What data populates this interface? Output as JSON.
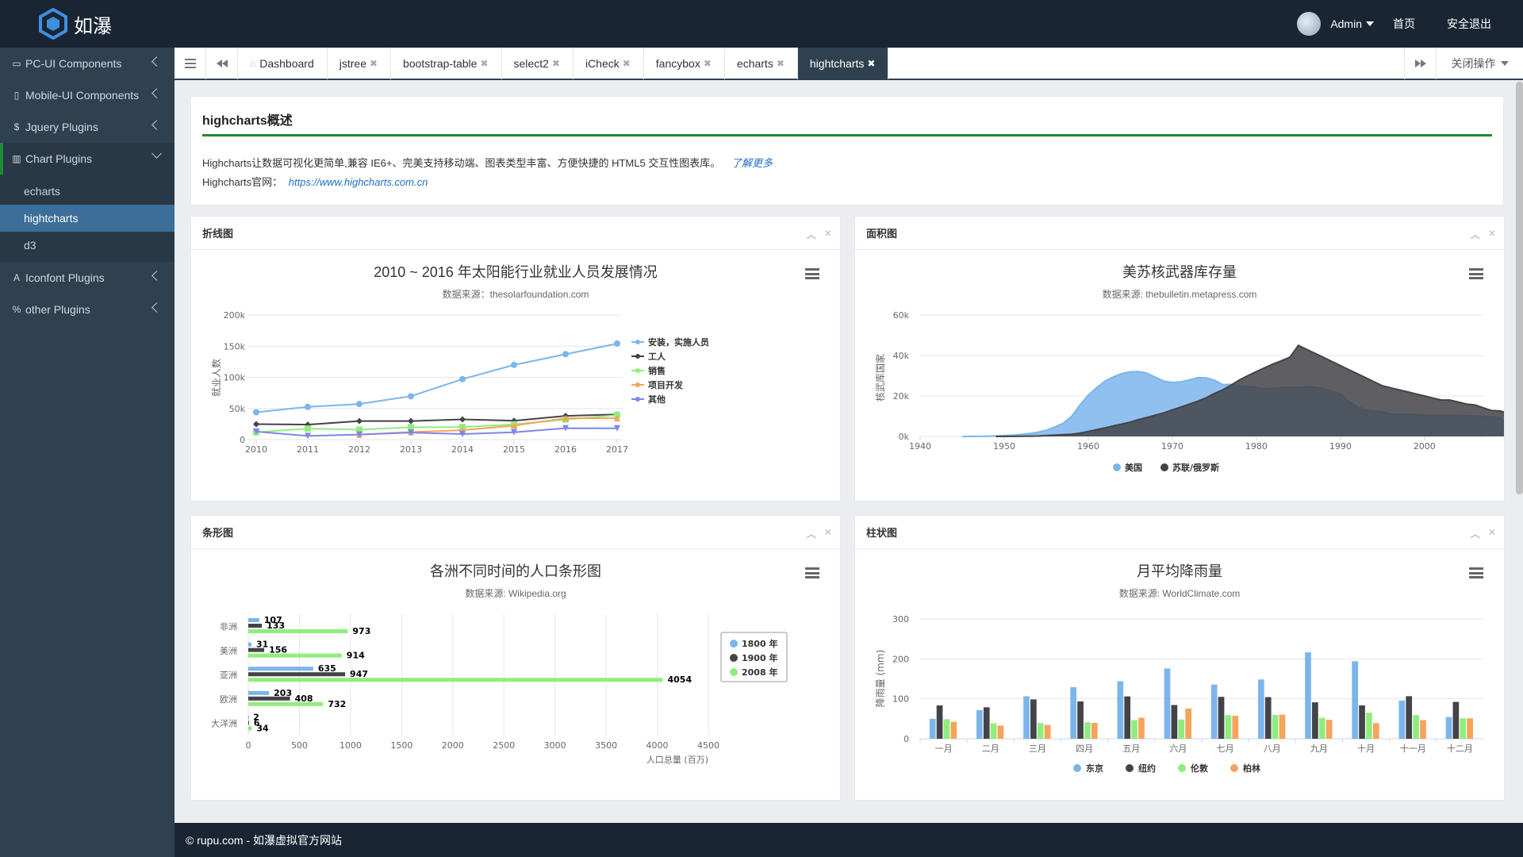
{
  "brand": {
    "name": "如瀑"
  },
  "topnav": {
    "user": "Admin",
    "home": "首页",
    "logout": "安全退出"
  },
  "sidebar": {
    "items": [
      {
        "icon": "desktop-icon",
        "glyph": "▭",
        "label": "PC-UI Components"
      },
      {
        "icon": "mobile-icon",
        "glyph": "▯",
        "label": "Mobile-UI Components"
      },
      {
        "icon": "dollar-icon",
        "glyph": "$",
        "label": "Jquery Plugins"
      },
      {
        "icon": "bar-chart-icon",
        "glyph": "▥",
        "label": "Chart Plugins",
        "open": true,
        "sub": [
          "echarts",
          "hightcharts",
          "d3"
        ],
        "active": "hightcharts"
      },
      {
        "icon": "font-icon",
        "glyph": "A",
        "label": "Iconfont Plugins"
      },
      {
        "icon": "link-icon",
        "glyph": "%",
        "label": "other Plugins"
      }
    ]
  },
  "tabs": {
    "items": [
      "Dashboard",
      "jstree",
      "bootstrap-table",
      "select2",
      "iCheck",
      "fancybox",
      "echarts",
      "hightcharts"
    ],
    "active": "hightcharts",
    "close_ops": "关闭操作"
  },
  "overview": {
    "title": "highcharts概述",
    "text": "Highcharts让数据可视化更简单,兼容 IE6+、完美支持移动端、图表类型丰富、方便快捷的 HTML5 交互性图表库。",
    "more": "了解更多",
    "site_label": "Highcharts官网：",
    "site_url": "https://www.highcharts.com.cn"
  },
  "panels": {
    "line": "折线图",
    "area": "面积图",
    "bar": "条形图",
    "column": "柱状图"
  },
  "colors": {
    "blue": "#7cb5ec",
    "dark": "#434348",
    "green": "#90ed7d",
    "orange": "#f7a35c",
    "purple": "#8085e9",
    "accent": "#1d8a34",
    "sidebar": "#2f4050",
    "topbar": "#1a2533"
  },
  "footer": "© rupu.com - 如瀑虚拟官方网站",
  "chart_data": [
    {
      "type": "line",
      "title": "2010 ~ 2016 年太阳能行业就业人员发展情况",
      "subtitle": "数据来源：thesolarfoundation.com",
      "ylabel": "就业人数",
      "ylim": [
        0,
        200000
      ],
      "yticks": [
        "0",
        "50k",
        "100k",
        "150k",
        "200k"
      ],
      "x": [
        "2010",
        "2011",
        "2012",
        "2013",
        "2014",
        "2015",
        "2016",
        "2017"
      ],
      "legend_position": "right",
      "series": [
        {
          "name": "安装，实施人员",
          "color": "#7cb5ec",
          "marker": "circle",
          "values": [
            43934,
            52503,
            57177,
            69658,
            97031,
            119931,
            137133,
            154175
          ]
        },
        {
          "name": "工人",
          "color": "#434348",
          "marker": "diamond",
          "values": [
            24916,
            24064,
            29742,
            29851,
            32490,
            30282,
            38121,
            40434
          ]
        },
        {
          "name": "销售",
          "color": "#90ed7d",
          "marker": "square",
          "values": [
            11744,
            17722,
            16005,
            19771,
            20185,
            24377,
            32147,
            39387
          ]
        },
        {
          "name": "项目开发",
          "color": "#f7a35c",
          "marker": "triangle",
          "values": [
            null,
            null,
            7988,
            12169,
            15112,
            22452,
            34400,
            34227
          ]
        },
        {
          "name": "其他",
          "color": "#8085e9",
          "marker": "triangle-down",
          "values": [
            12908,
            5948,
            8105,
            11248,
            8989,
            11816,
            18274,
            18111
          ]
        }
      ]
    },
    {
      "type": "area",
      "title": "美苏核武器库存量",
      "subtitle": "数据来源: thebulletin.metapress.com",
      "ylabel": "核武库国家",
      "ylim": [
        0,
        60000
      ],
      "yticks": [
        "0k",
        "20k",
        "40k",
        "60k"
      ],
      "xticks": [
        "1940",
        "1950",
        "1960",
        "1970",
        "1980",
        "1990",
        "2000"
      ],
      "xlim": [
        1940,
        2007
      ],
      "legend_position": "bottom",
      "series": [
        {
          "name": "美国",
          "color": "#7cb5ec",
          "start": 1945,
          "values": [
            6,
            11,
            32,
            110,
            235,
            369,
            640,
            1005,
            1436,
            2063,
            3057,
            4618,
            6444,
            9822,
            15468,
            20434,
            24126,
            27387,
            29459,
            31056,
            31982,
            32040,
            31233,
            29224,
            27342,
            26662,
            26956,
            27912,
            28999,
            28965,
            27826,
            25579,
            25722,
            24826,
            24605,
            24304,
            23464,
            23708,
            24099,
            24357,
            24237,
            24401,
            24344,
            23586,
            22380,
            21004,
            17287,
            14747,
            13076,
            12555,
            12144,
            11009,
            10950,
            10871,
            10824,
            10577,
            10527,
            10475,
            10421,
            10358,
            10295,
            10104,
            9914,
            9620,
            9326,
            5113,
            5113,
            4954,
            4804,
            4761,
            4717,
            4368,
            4018
          ]
        },
        {
          "name": "苏联/俄罗斯",
          "color": "#434348",
          "start": 1945,
          "values": [
            null,
            null,
            null,
            null,
            5,
            25,
            50,
            120,
            150,
            200,
            426,
            660,
            869,
            1060,
            1605,
            2471,
            3322,
            4238,
            5221,
            6129,
            7089,
            8339,
            9399,
            10538,
            11643,
            13092,
            14478,
            15915,
            17385,
            19055,
            21205,
            23044,
            25393,
            27935,
            30062,
            32049,
            33952,
            35804,
            37431,
            39197,
            45000,
            43000,
            41000,
            39000,
            37000,
            35000,
            33000,
            31000,
            29000,
            27000,
            25000,
            24000,
            23000,
            22000,
            21000,
            20000,
            19000,
            18000,
            18000,
            17000,
            16000,
            15537,
            14162,
            12787,
            12600,
            11400,
            5500,
            4512,
            4502,
            4502,
            4500,
            4500
          ]
        }
      ]
    },
    {
      "type": "bar",
      "title": "各洲不同时间的人口条形图",
      "subtitle": "数据来源: Wikipedia.org",
      "xlabel": "人口总量 (百万)",
      "xlim": [
        0,
        4500
      ],
      "xticks": [
        "0",
        "500",
        "1000",
        "1500",
        "2000",
        "2500",
        "3000",
        "3500",
        "4000",
        "4500"
      ],
      "categories": [
        "非洲",
        "美洲",
        "亚洲",
        "欧洲",
        "大洋洲"
      ],
      "legend_position": "top-right",
      "series": [
        {
          "name": "1800 年",
          "color": "#7cb5ec",
          "values": [
            107,
            31,
            635,
            203,
            2
          ]
        },
        {
          "name": "1900 年",
          "color": "#434348",
          "values": [
            133,
            156,
            947,
            408,
            6
          ]
        },
        {
          "name": "2008 年",
          "color": "#90ed7d",
          "values": [
            973,
            914,
            4054,
            732,
            34
          ]
        }
      ]
    },
    {
      "type": "bar",
      "title": "月平均降雨量",
      "subtitle": "数据来源: WorldClimate.com",
      "ylabel": "降雨量 (mm)",
      "ylim": [
        0,
        300
      ],
      "yticks": [
        "0",
        "100",
        "200",
        "300"
      ],
      "categories": [
        "一月",
        "二月",
        "三月",
        "四月",
        "五月",
        "六月",
        "七月",
        "八月",
        "九月",
        "十月",
        "十一月",
        "十二月"
      ],
      "legend_position": "bottom",
      "series": [
        {
          "name": "东京",
          "color": "#7cb5ec",
          "values": [
            49.9,
            71.5,
            106.4,
            129.2,
            144.0,
            176.0,
            135.6,
            148.5,
            216.4,
            194.1,
            95.6,
            54.4
          ]
        },
        {
          "name": "纽约",
          "color": "#434348",
          "values": [
            83.6,
            78.8,
            98.5,
            93.4,
            106.0,
            84.5,
            105.0,
            104.3,
            91.2,
            83.5,
            106.6,
            92.3
          ]
        },
        {
          "name": "伦敦",
          "color": "#90ed7d",
          "values": [
            48.9,
            38.8,
            39.3,
            41.4,
            47.0,
            48.3,
            59.0,
            59.6,
            52.4,
            65.2,
            59.3,
            51.2
          ]
        },
        {
          "name": "柏林",
          "color": "#f7a35c",
          "values": [
            42.4,
            33.2,
            34.5,
            39.7,
            52.6,
            75.5,
            57.4,
            60.4,
            47.6,
            39.1,
            46.8,
            51.1
          ]
        }
      ]
    }
  ]
}
